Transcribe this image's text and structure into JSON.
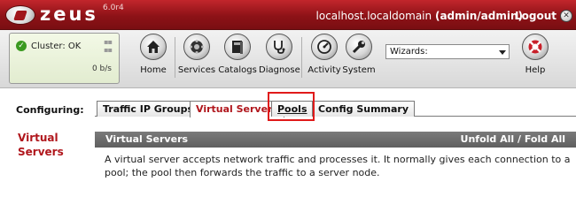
{
  "header": {
    "brand": "zeus",
    "version": "6.0r4",
    "host": "localhost.localdomain",
    "user": "(admin/admin)",
    "logout_label": "Logout"
  },
  "cluster": {
    "status_label": "Cluster: OK",
    "rate": "0 b/s"
  },
  "toolbar": {
    "items": [
      {
        "label": "Home",
        "icon": "home-icon"
      },
      {
        "label": "Services",
        "icon": "services-icon"
      },
      {
        "label": "Catalogs",
        "icon": "catalogs-icon"
      },
      {
        "label": "Diagnose",
        "icon": "diagnose-icon"
      },
      {
        "label": "Activity",
        "icon": "activity-icon"
      },
      {
        "label": "System",
        "icon": "system-icon"
      },
      {
        "label": "Help",
        "icon": "help-icon"
      }
    ],
    "wizards_value": "Wizards:"
  },
  "config": {
    "label": "Configuring:",
    "tabs": [
      {
        "label": "Traffic IP Groups"
      },
      {
        "label": "Virtual Servers"
      },
      {
        "label": "Pools"
      },
      {
        "label": "Config Summary"
      }
    ]
  },
  "content": {
    "side_title": "Virtual Servers",
    "section_title": "Virtual Servers",
    "fold_label": "Unfold All / Fold All",
    "description": "A virtual server accepts network traffic and processes it. It normally gives each connection to a pool; the pool then forwards the traffic to a server node."
  },
  "colors": {
    "brand_red": "#b0161c",
    "ok_green": "#3b9a20"
  }
}
